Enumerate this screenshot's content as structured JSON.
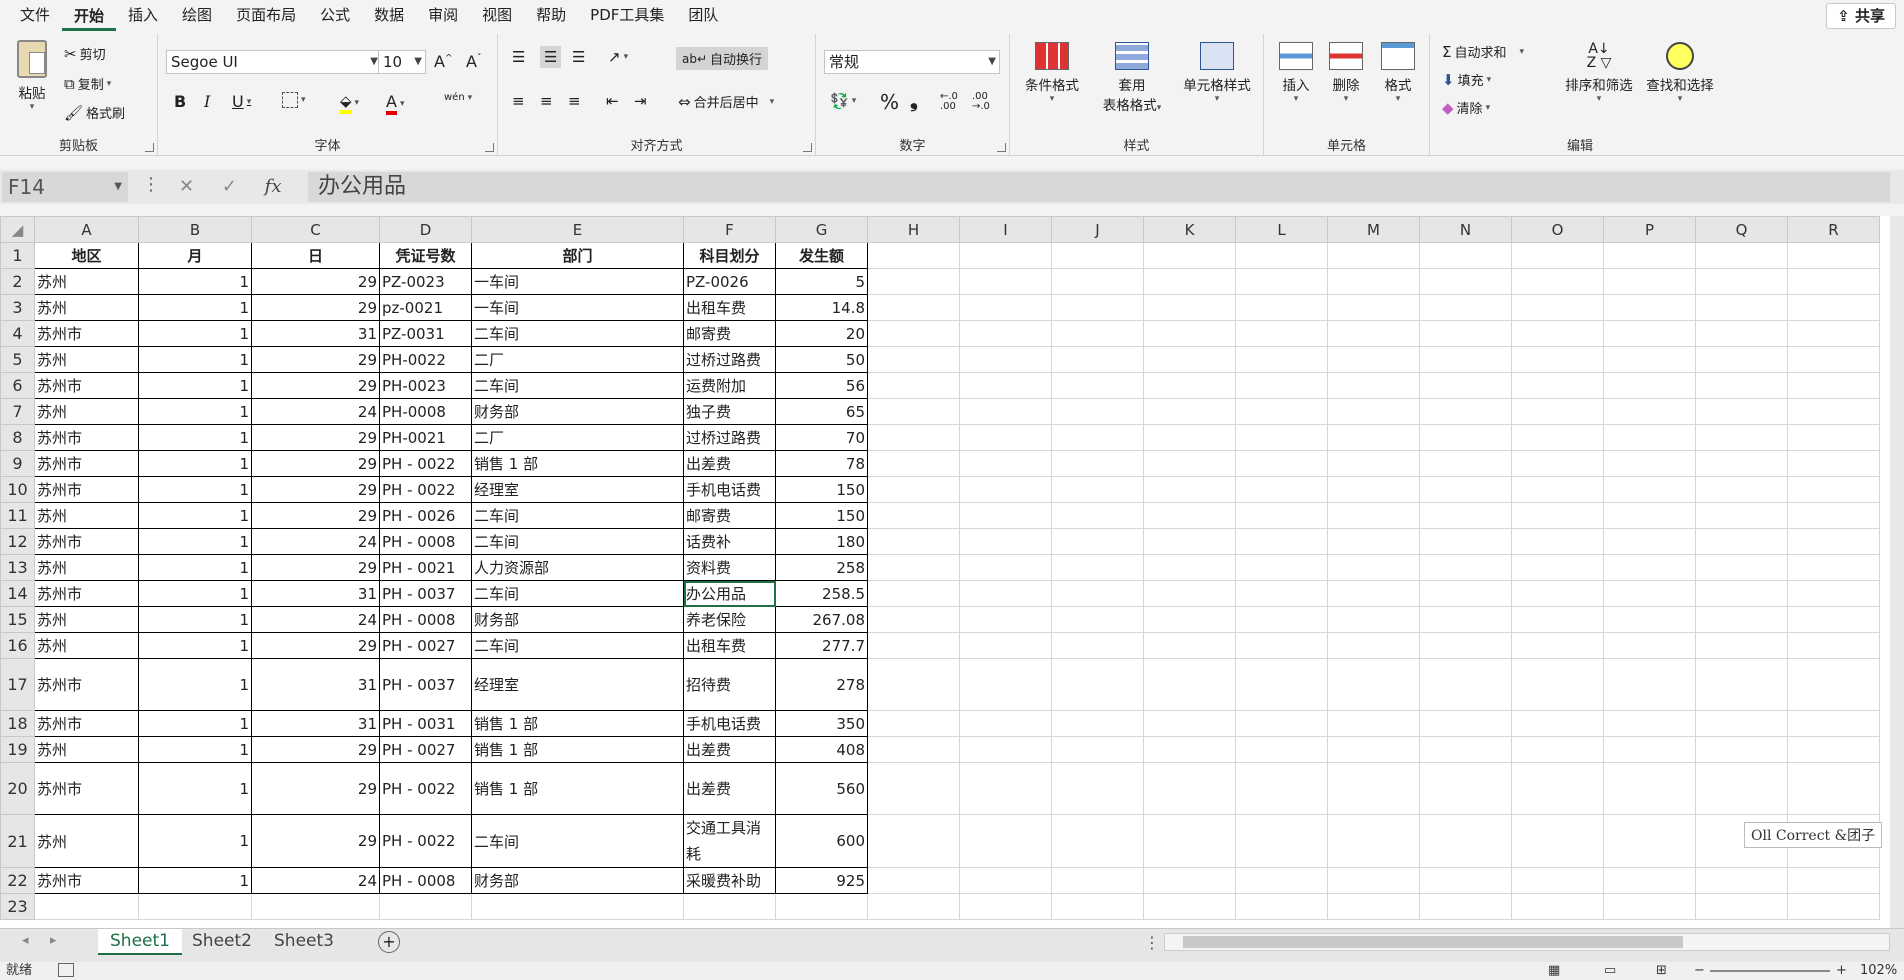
{
  "menu": [
    "文件",
    "开始",
    "插入",
    "绘图",
    "页面布局",
    "公式",
    "数据",
    "审阅",
    "视图",
    "帮助",
    "PDF工具集",
    "团队"
  ],
  "share_label": "共享",
  "ribbon": {
    "clipboard": {
      "paste": "粘贴",
      "cut": "剪切",
      "copy": "复制",
      "painter": "格式刷",
      "label": "剪贴板"
    },
    "font": {
      "name": "Segoe UI",
      "size": "10",
      "label": "字体",
      "grow": "A^",
      "shrink": "Aˇ",
      "bold": "B",
      "italic": "I",
      "underline": "U",
      "phonetic": "wén"
    },
    "align": {
      "wrap": "自动换行",
      "merge": "合并后居中",
      "label": "对齐方式"
    },
    "number": {
      "format": "常规",
      "label": "数字",
      "percent": "%",
      "comma": "❟",
      "inc": "←.0 .00",
      "dec": ".00 →.0"
    },
    "styles": {
      "cond": "条件格式",
      "table1": "套用",
      "table2": "表格格式",
      "cell": "单元格样式",
      "label": "样式"
    },
    "cells": {
      "insert": "插入",
      "delete": "删除",
      "format": "格式",
      "label": "单元格"
    },
    "edit": {
      "autosum": "自动求和",
      "fill": "填充",
      "clear": "清除",
      "sort": "排序和筛选",
      "find": "查找和选择",
      "label": "编辑"
    }
  },
  "namebox": "F14",
  "formula": "办公用品",
  "columns": [
    "A",
    "B",
    "C",
    "D",
    "E",
    "F",
    "G",
    "H",
    "I",
    "J",
    "K",
    "L",
    "M",
    "N",
    "O",
    "P",
    "Q",
    "R"
  ],
  "headers": [
    "地区",
    "月",
    "日",
    "凭证号数",
    "部门",
    "科目划分",
    "发生额"
  ],
  "rows": [
    [
      "苏州",
      "1",
      "29",
      "PZ-0023",
      "一车间",
      "PZ-0026",
      "5"
    ],
    [
      "苏州",
      "1",
      "29",
      "pz-0021",
      "一车间",
      "出租车费",
      "14.8"
    ],
    [
      "苏州市",
      "1",
      "31",
      "PZ-0031",
      "二车间",
      "邮寄费",
      "20"
    ],
    [
      "苏州",
      "1",
      "29",
      "PH-0022",
      "二厂",
      "过桥过路费",
      "50"
    ],
    [
      "苏州市",
      "1",
      "29",
      "PH-0023",
      "二车间",
      "运费附加",
      "56"
    ],
    [
      "苏州",
      "1",
      "24",
      "PH-0008",
      "财务部",
      "独子费",
      "65"
    ],
    [
      "苏州市",
      "1",
      "29",
      "PH-0021",
      "二厂",
      "过桥过路费",
      "70"
    ],
    [
      "苏州市",
      "1",
      "29",
      "PH - 0022",
      "销售 1 部",
      "出差费",
      "78"
    ],
    [
      "苏州市",
      "1",
      "29",
      "PH - 0022",
      "经理室",
      "手机电话费",
      "150"
    ],
    [
      "苏州",
      "1",
      "29",
      "PH - 0026",
      "二车间",
      "邮寄费",
      "150"
    ],
    [
      "苏州市",
      "1",
      "24",
      "PH - 0008",
      "二车间",
      "话费补",
      "180"
    ],
    [
      "苏州",
      "1",
      "29",
      "PH - 0021",
      "人力资源部",
      "资料费",
      "258"
    ],
    [
      "苏州市",
      "1",
      "31",
      "PH - 0037",
      "二车间",
      "办公用品",
      "258.5"
    ],
    [
      "苏州",
      "1",
      "24",
      "PH - 0008",
      "财务部",
      "养老保险",
      "267.08"
    ],
    [
      "苏州",
      "1",
      "29",
      "PH - 0027",
      "二车间",
      "出租车费",
      "277.7"
    ],
    [
      "苏州市",
      "1",
      "31",
      "PH - 0037",
      "经理室",
      "招待费",
      "278"
    ],
    [
      "苏州市",
      "1",
      "31",
      "PH - 0031",
      "销售 1 部",
      "手机电话费",
      "350"
    ],
    [
      "苏州",
      "1",
      "29",
      "PH - 0027",
      "销售 1 部",
      "出差费",
      "408"
    ],
    [
      "苏州市",
      "1",
      "29",
      "PH - 0022",
      "销售 1 部",
      "出差费",
      "560"
    ],
    [
      "苏州",
      "1",
      "29",
      "PH - 0022",
      "二车间",
      "交通工具消耗",
      "600"
    ],
    [
      "苏州市",
      "1",
      "24",
      "PH - 0008",
      "财务部",
      "采暖费补助",
      "925"
    ]
  ],
  "sheets": [
    "Sheet1",
    "Sheet2",
    "Sheet3"
  ],
  "status": {
    "ready": "就绪",
    "zoom": "102%"
  },
  "tooltip": "Oll Correct &团子"
}
